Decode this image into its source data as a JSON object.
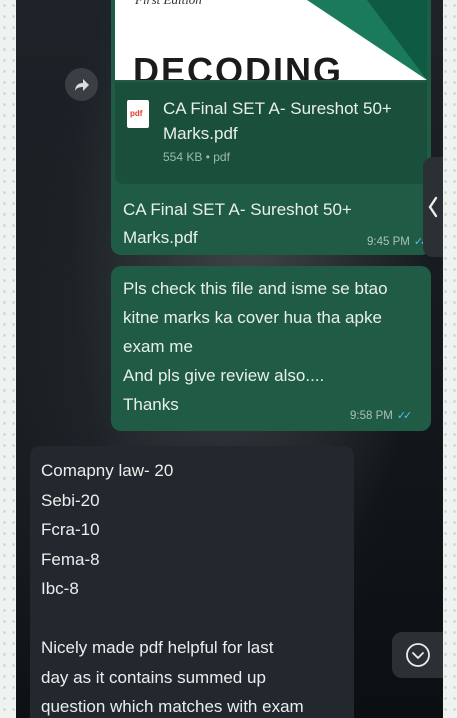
{
  "document_message": {
    "preview": {
      "edition": "First Edition",
      "title": "DECODING"
    },
    "file": {
      "icon_label": "pdf",
      "name": "CA Final SET A- Sureshot 50+ Marks.pdf",
      "meta": "554 KB • pdf"
    },
    "caption": "CA Final SET A- Sureshot 50+ Marks.pdf",
    "time": "9:45 PM"
  },
  "sent_message": {
    "lines": [
      "Pls check this file and isme se btao",
      "kitne marks ka cover hua tha apke",
      "exam me",
      "And pls give review also....",
      "Thanks"
    ],
    "time": "9:58 PM"
  },
  "received_message": {
    "lines": [
      "Comapny law- 20",
      "Sebi-20",
      "Fcra-10",
      "Fema-8",
      "Ibc-8",
      "",
      "Nicely made pdf helpful for last",
      "day as it contains summed up",
      "question which matches with exam"
    ]
  },
  "icons": {
    "forward": "forward-arrow-icon",
    "side_tab": "chevron-left-icon",
    "scroll_down": "chevron-down-circle-icon",
    "read_receipt": "double-check-icon"
  },
  "colors": {
    "outgoing_bubble": "#1f5b45",
    "incoming_bubble": "#22282d",
    "read_tick": "#53bdeb"
  }
}
